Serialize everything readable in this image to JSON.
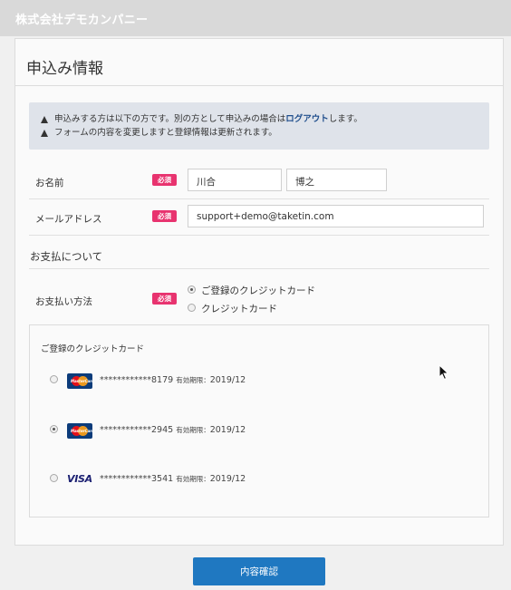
{
  "header": {
    "company": "株式会社デモカンパニー"
  },
  "page": {
    "title": "申込み情報"
  },
  "notice": {
    "line1_before": "申込みする方は以下の方です。別の方として申込みの場合は",
    "line1_link": "ログアウト",
    "line1_after": "します。",
    "line2": "フォームの内容を変更しますと登録情報は更新されます。"
  },
  "name_field": {
    "label": "お名前",
    "required": "必須",
    "last_name": "川合",
    "first_name": "博之"
  },
  "email_field": {
    "label": "メールアドレス",
    "required": "必須",
    "value": "support+demo@taketin.com"
  },
  "payment_section": {
    "heading": "お支払について"
  },
  "payment_method": {
    "label": "お支払い方法",
    "required": "必須",
    "options": [
      {
        "label": "ご登録のクレジットカード",
        "selected": true
      },
      {
        "label": "クレジットカード",
        "selected": false
      }
    ]
  },
  "registered_cards": {
    "title": "ご登録のクレジットカード",
    "cards": [
      {
        "brand": "mastercard-icon",
        "number": "************8179",
        "expiry_label": "有効期限：",
        "expiry": "2019/12",
        "selected": false
      },
      {
        "brand": "mastercard-icon",
        "number": "************2945",
        "expiry_label": "有効期限：",
        "expiry": "2019/12",
        "selected": true
      },
      {
        "brand": "visa-icon",
        "brand_text": "VISA",
        "number": "************3541",
        "expiry_label": "有効期限：",
        "expiry": "2019/12",
        "selected": false
      }
    ]
  },
  "actions": {
    "confirm_label": "内容確認"
  },
  "colors": {
    "required_badge": "#e8336f",
    "primary_button": "#1f78c1",
    "link": "#1f4e8c"
  }
}
